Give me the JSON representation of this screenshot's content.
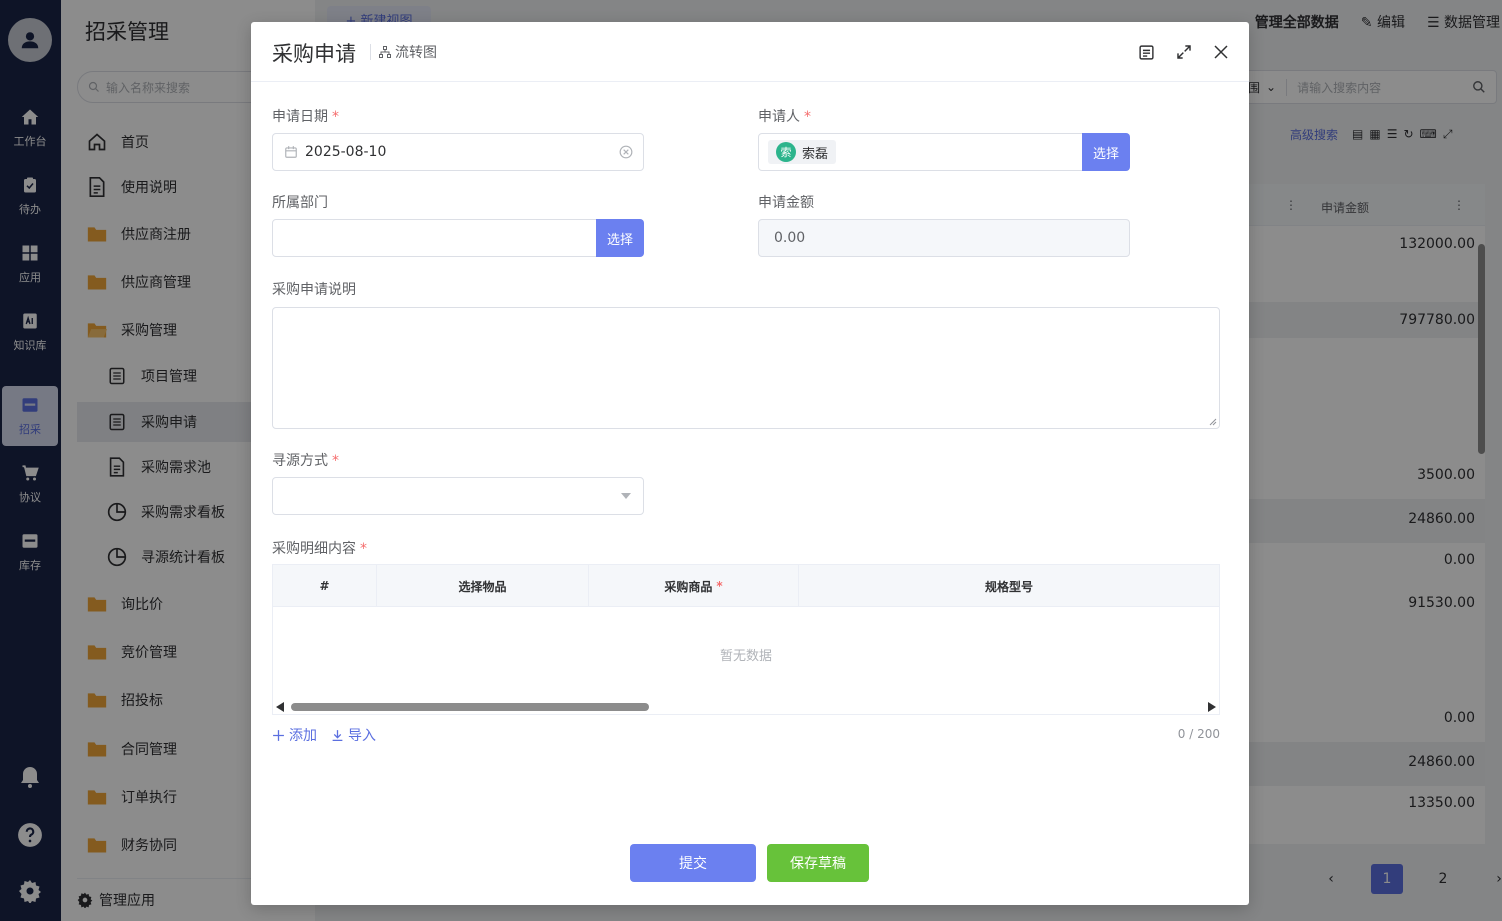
{
  "rail": {
    "items": [
      {
        "label": "工作台",
        "icon": "home-icon"
      },
      {
        "label": "待办",
        "icon": "clipboard-icon"
      },
      {
        "label": "应用",
        "icon": "grid-icon"
      },
      {
        "label": "知识库",
        "icon": "ai-book-icon"
      },
      {
        "label": "招采",
        "icon": "srm-icon"
      },
      {
        "label": "协议",
        "icon": "cart-icon"
      },
      {
        "label": "库存",
        "icon": "wms-icon"
      }
    ]
  },
  "sidebar": {
    "title": "招采管理",
    "search_placeholder": "输入名称来搜索",
    "items": [
      {
        "label": "首页"
      },
      {
        "label": "使用说明"
      },
      {
        "label": "供应商注册"
      },
      {
        "label": "供应商管理"
      },
      {
        "label": "采购管理"
      },
      {
        "label": "项目管理"
      },
      {
        "label": "采购申请"
      },
      {
        "label": "采购需求池"
      },
      {
        "label": "采购需求看板"
      },
      {
        "label": "寻源统计看板"
      },
      {
        "label": "询比价"
      },
      {
        "label": "竞价管理"
      },
      {
        "label": "招投标"
      },
      {
        "label": "合同管理"
      },
      {
        "label": "订单执行"
      },
      {
        "label": "财务协同"
      }
    ],
    "footer": "管理应用"
  },
  "background": {
    "new_view": "+ 新建视图",
    "top_right": [
      "管理全部数据",
      "编辑",
      "数据管理"
    ],
    "scope_label": "围",
    "search_placeholder": "请输入搜索内容",
    "advanced_search": "高级搜索",
    "column_header": "申请金额",
    "rows": [
      "132000.00",
      "797780.00",
      "3500.00",
      "24860.00",
      "0.00",
      "91530.00",
      "0.00",
      "24860.00",
      "13350.00"
    ],
    "pager": [
      "1",
      "2"
    ]
  },
  "dialog": {
    "title": "采购申请",
    "flow_label": "流转图",
    "fields": {
      "apply_date": {
        "label": "申请日期",
        "value": "2025-08-10"
      },
      "applicant": {
        "label": "申请人",
        "chip_avatar": "索",
        "chip_name": "索磊",
        "select_label": "选择"
      },
      "department": {
        "label": "所属部门",
        "value": "",
        "select_label": "选择"
      },
      "amount": {
        "label": "申请金额",
        "value": "0.00"
      },
      "description": {
        "label": "采购申请说明",
        "value": ""
      },
      "sourcing": {
        "label": "寻源方式",
        "value": ""
      },
      "details": {
        "label": "采购明细内容"
      }
    },
    "grid": {
      "columns": [
        "#",
        "选择物品",
        "采购商品",
        "规格型号"
      ],
      "empty_text": "暂无数据",
      "add_label": "添加",
      "import_label": "导入",
      "count": "0 / 200"
    },
    "buttons": {
      "submit": "提交",
      "save_draft": "保存草稿"
    },
    "required_mark": "*"
  },
  "colors": {
    "primary": "#6b80f0",
    "success": "#67c23a",
    "rail_bg": "#1b2547",
    "required": "#f56c6c"
  }
}
